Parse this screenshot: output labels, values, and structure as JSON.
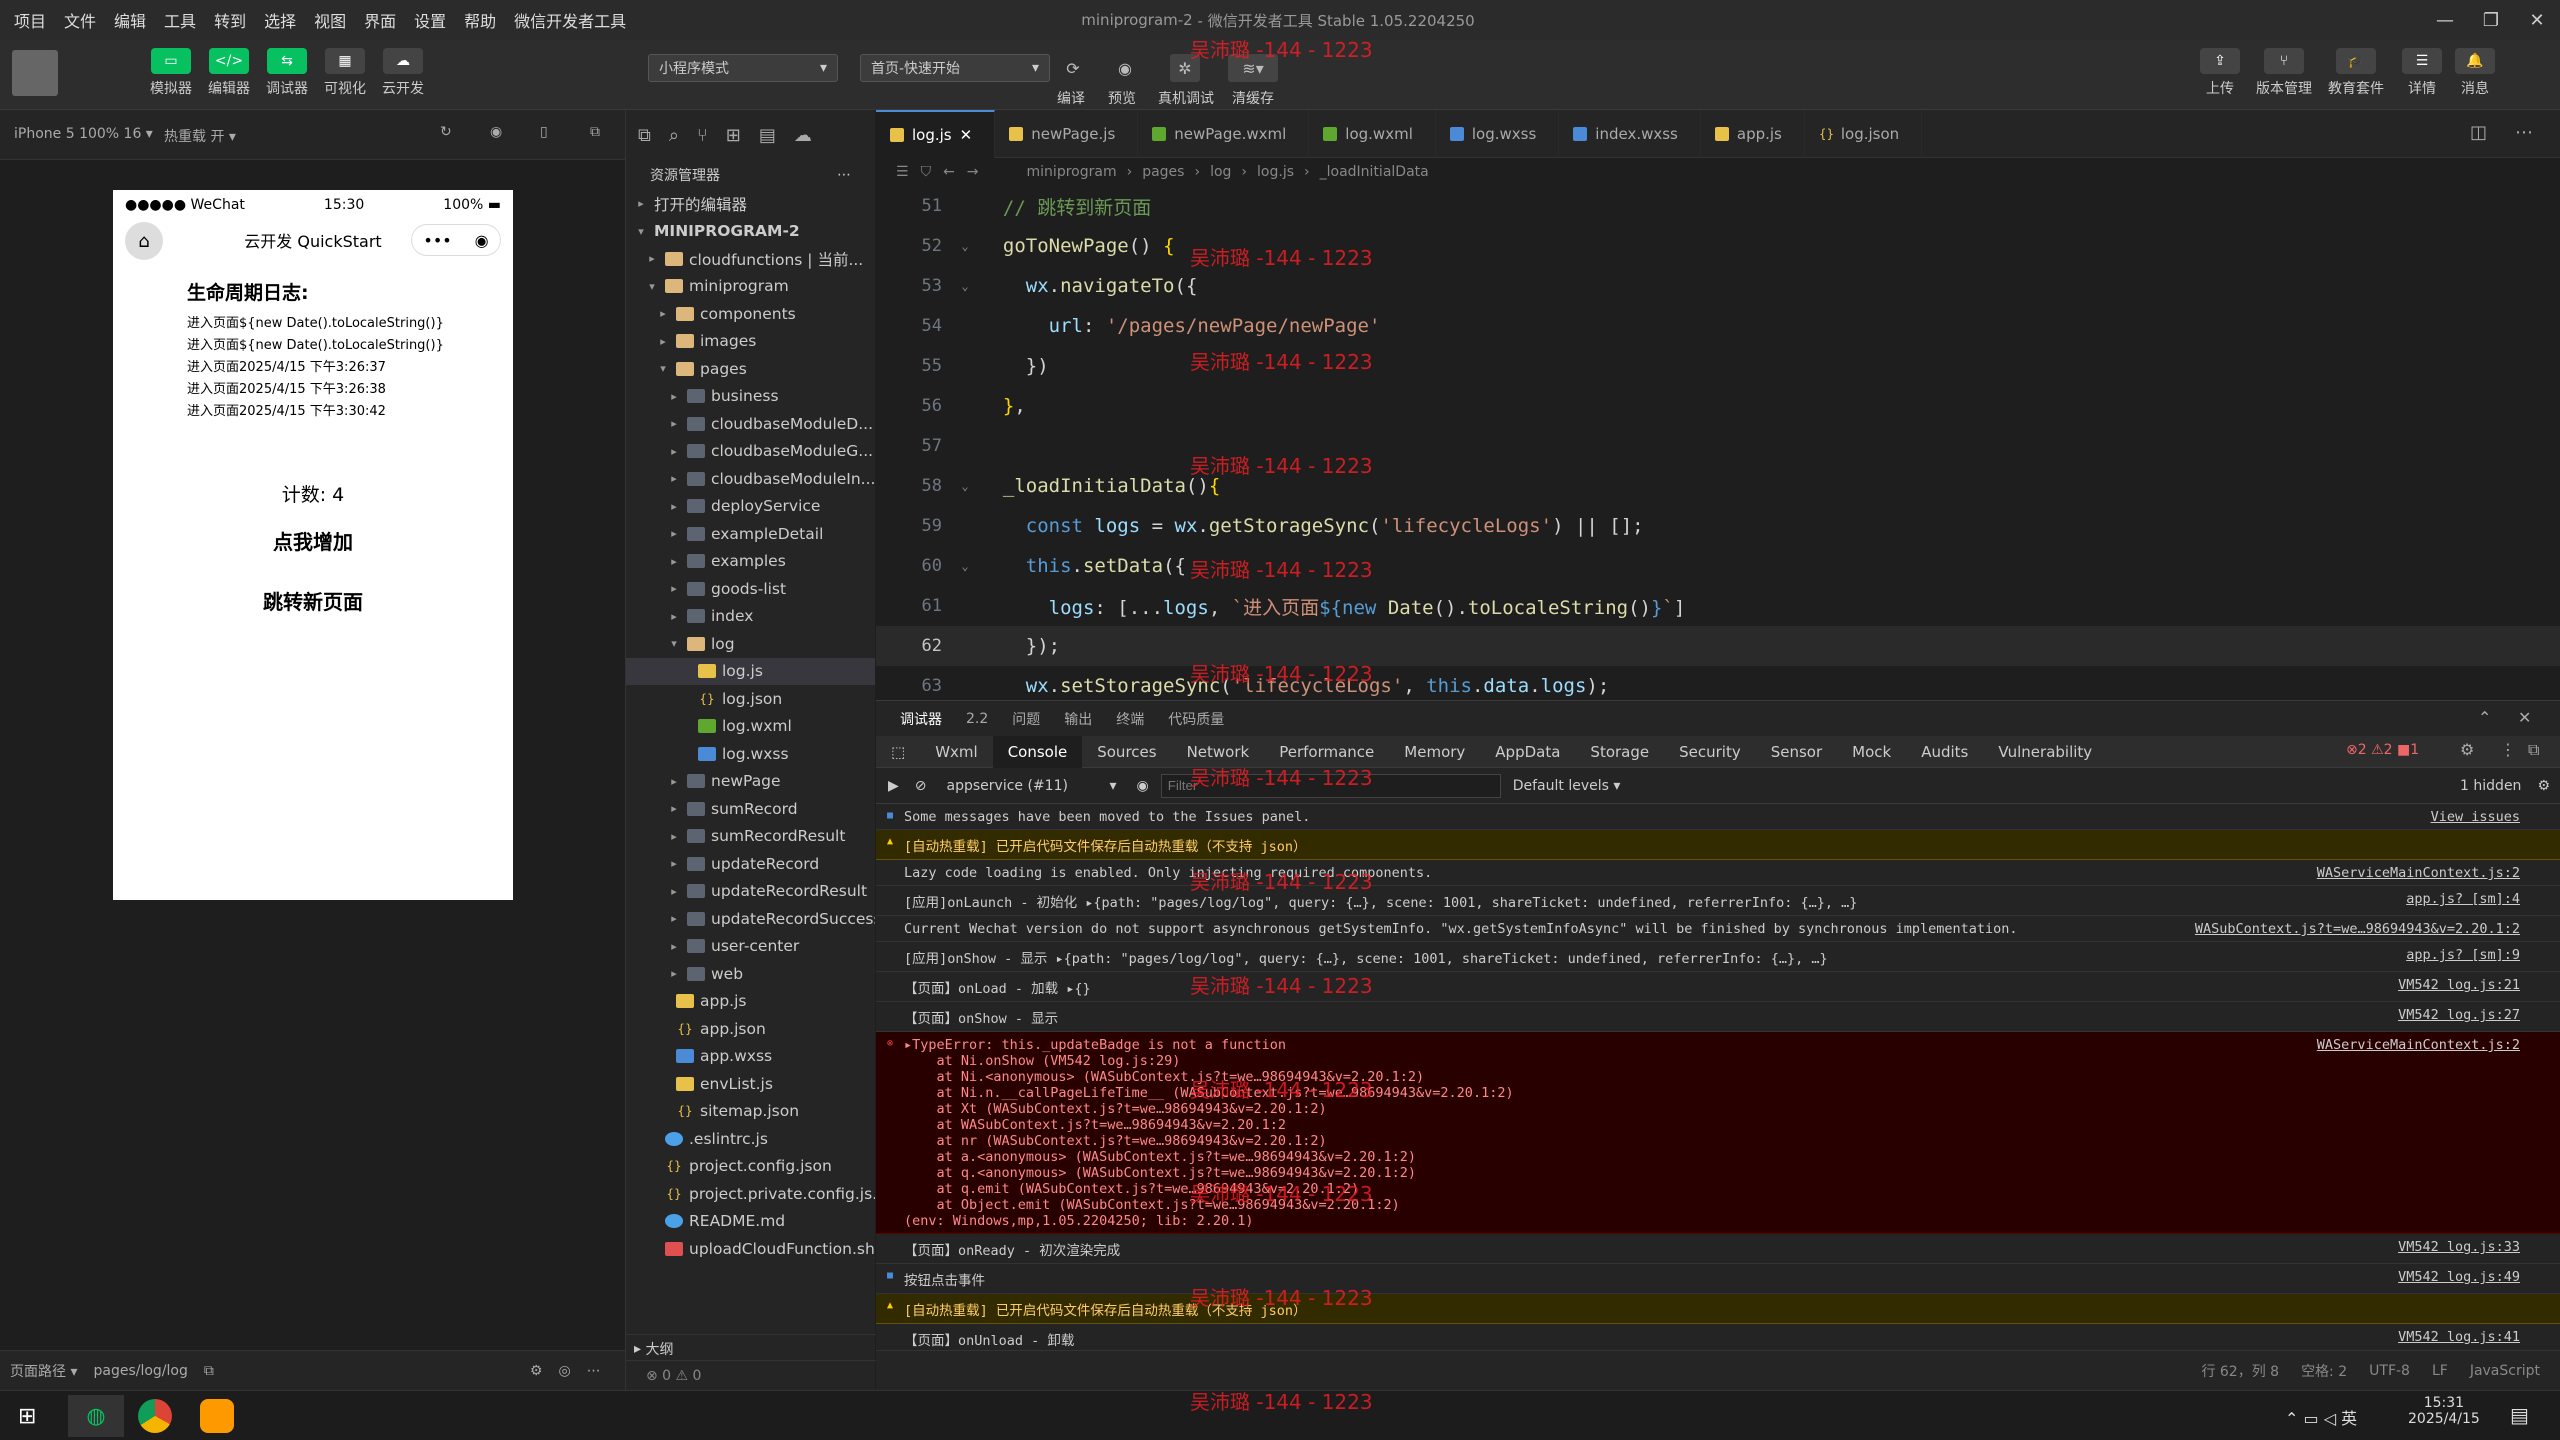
{
  "window": {
    "title": "miniprogram-2",
    "subtitle": "- 微信开发者工具 Stable 1.05.2204250"
  },
  "menu": [
    "项目",
    "文件",
    "编辑",
    "工具",
    "转到",
    "选择",
    "视图",
    "界面",
    "设置",
    "帮助",
    "微信开发者工具"
  ],
  "toolbar": {
    "left_buttons": [
      {
        "label": "模拟器",
        "icon": "phone-icon"
      },
      {
        "label": "编辑器",
        "icon": "code-icon"
      },
      {
        "label": "调试器",
        "icon": "debug-icon"
      },
      {
        "label": "可视化",
        "icon": "layout-icon"
      },
      {
        "label": "云开发",
        "icon": "cloud-icon"
      }
    ],
    "mode_select": "小程序模式",
    "compile_select": "首页-快速开始",
    "mid_labels": [
      "编译",
      "预览",
      "真机调试",
      "清缓存"
    ],
    "right_buttons": [
      "上传",
      "版本管理",
      "教育套件",
      "详情",
      "消息"
    ]
  },
  "sim": {
    "device": "iPhone 5 100% 16 ▾",
    "hot_reload": "热重载 开 ▾",
    "status_left": "●●●●● WeChat",
    "status_time": "15:30",
    "status_right": "100%",
    "nav_title": "云开发 QuickStart",
    "heading": "生命周期日志:",
    "logs": [
      "进入页面${new Date().toLocaleString()}",
      "进入页面${new Date().toLocaleString()}",
      "进入页面2025/4/15 下午3:26:37",
      "进入页面2025/4/15 下午3:26:38",
      "进入页面2025/4/15 下午3:30:42"
    ],
    "count": "计数: 4",
    "inc_button": "点我增加",
    "jump_button": "跳转新页面",
    "footer_path_label": "页面路径 ▾",
    "footer_path": "pages/log/log"
  },
  "explorer": {
    "title": "资源管理器",
    "open_editors": "打开的编辑器",
    "project": "MINIPROGRAM-2",
    "outline": "大纲",
    "problems": "⊗ 0 ⚠ 0",
    "tree": [
      {
        "d": 1,
        "arr": "▸",
        "type": "folder special",
        "name": "cloudfunctions | 当前..."
      },
      {
        "d": 1,
        "arr": "▾",
        "type": "folder special",
        "name": "miniprogram"
      },
      {
        "d": 2,
        "arr": "▸",
        "type": "folder special",
        "name": "components"
      },
      {
        "d": 2,
        "arr": "▸",
        "type": "folder special",
        "name": "images"
      },
      {
        "d": 2,
        "arr": "▾",
        "type": "folder special",
        "name": "pages"
      },
      {
        "d": 3,
        "arr": "▸",
        "type": "folder",
        "name": "business"
      },
      {
        "d": 3,
        "arr": "▸",
        "type": "folder",
        "name": "cloudbaseModuleD..."
      },
      {
        "d": 3,
        "arr": "▸",
        "type": "folder",
        "name": "cloudbaseModuleG..."
      },
      {
        "d": 3,
        "arr": "▸",
        "type": "folder",
        "name": "cloudbaseModuleIn..."
      },
      {
        "d": 3,
        "arr": "▸",
        "type": "folder",
        "name": "deployService"
      },
      {
        "d": 3,
        "arr": "▸",
        "type": "folder",
        "name": "exampleDetail"
      },
      {
        "d": 3,
        "arr": "▸",
        "type": "folder",
        "name": "examples"
      },
      {
        "d": 3,
        "arr": "▸",
        "type": "folder",
        "name": "goods-list"
      },
      {
        "d": 3,
        "arr": "▸",
        "type": "folder",
        "name": "index"
      },
      {
        "d": 3,
        "arr": "▾",
        "type": "folder special",
        "name": "log"
      },
      {
        "d": 4,
        "arr": "",
        "type": "js",
        "name": "log.js",
        "sel": true
      },
      {
        "d": 4,
        "arr": "",
        "type": "json",
        "name": "log.json"
      },
      {
        "d": 4,
        "arr": "",
        "type": "wxml",
        "name": "log.wxml"
      },
      {
        "d": 4,
        "arr": "",
        "type": "wxss",
        "name": "log.wxss"
      },
      {
        "d": 3,
        "arr": "▸",
        "type": "folder",
        "name": "newPage"
      },
      {
        "d": 3,
        "arr": "▸",
        "type": "folder",
        "name": "sumRecord"
      },
      {
        "d": 3,
        "arr": "▸",
        "type": "folder",
        "name": "sumRecordResult"
      },
      {
        "d": 3,
        "arr": "▸",
        "type": "folder",
        "name": "updateRecord"
      },
      {
        "d": 3,
        "arr": "▸",
        "type": "folder",
        "name": "updateRecordResult"
      },
      {
        "d": 3,
        "arr": "▸",
        "type": "folder",
        "name": "updateRecordSuccess"
      },
      {
        "d": 3,
        "arr": "▸",
        "type": "folder",
        "name": "user-center"
      },
      {
        "d": 3,
        "arr": "▸",
        "type": "folder",
        "name": "web"
      },
      {
        "d": 2,
        "arr": "",
        "type": "js",
        "name": "app.js"
      },
      {
        "d": 2,
        "arr": "",
        "type": "json",
        "name": "app.json"
      },
      {
        "d": 2,
        "arr": "",
        "type": "wxss",
        "name": "app.wxss"
      },
      {
        "d": 2,
        "arr": "",
        "type": "js",
        "name": "envList.js"
      },
      {
        "d": 2,
        "arr": "",
        "type": "json",
        "name": "sitemap.json"
      },
      {
        "d": 1,
        "arr": "",
        "type": "md",
        "name": ".eslintrc.js"
      },
      {
        "d": 1,
        "arr": "",
        "type": "json",
        "name": "project.config.json"
      },
      {
        "d": 1,
        "arr": "",
        "type": "json",
        "name": "project.private.config.js..."
      },
      {
        "d": 1,
        "arr": "",
        "type": "md",
        "name": "README.md"
      },
      {
        "d": 1,
        "arr": "",
        "type": "sh",
        "name": "uploadCloudFunction.sh"
      }
    ]
  },
  "tabs": [
    {
      "name": "log.js",
      "type": "js",
      "active": true
    },
    {
      "name": "newPage.js",
      "type": "js"
    },
    {
      "name": "newPage.wxml",
      "type": "wxml"
    },
    {
      "name": "log.wxml",
      "type": "wxml"
    },
    {
      "name": "log.wxss",
      "type": "wxss"
    },
    {
      "name": "index.wxss",
      "type": "wxss"
    },
    {
      "name": "app.js",
      "type": "js"
    },
    {
      "name": "log.json",
      "type": "json"
    }
  ],
  "breadcrumb": [
    "miniprogram",
    "pages",
    "log",
    "log.js",
    "_loadInitialData"
  ],
  "code": [
    {
      "n": "51",
      "html": "  <span class='c'>// 跳转到新页面</span>"
    },
    {
      "n": "52",
      "fold": "⌄",
      "html": "  <span class='f'>goToNewPage</span>() <span class='y'>{</span>"
    },
    {
      "n": "53",
      "fold": "⌄",
      "html": "    <span class='p'>wx</span>.<span class='f'>navigateTo</span>({"
    },
    {
      "n": "54",
      "html": "      <span class='p'>url</span>: <span class='s'>'/pages/newPage/newPage'</span>"
    },
    {
      "n": "55",
      "html": "    })"
    },
    {
      "n": "56",
      "html": "  <span class='y'>}</span>,"
    },
    {
      "n": "57",
      "html": ""
    },
    {
      "n": "58",
      "fold": "⌄",
      "html": "  <span class='f'>_loadInitialData</span>()<span class='y'>{</span>"
    },
    {
      "n": "59",
      "html": "    <span class='k'>const</span> <span class='p'>logs</span> = <span class='p'>wx</span>.<span class='f'>getStorageSync</span>(<span class='s'>'lifecycleLogs'</span>) || [];"
    },
    {
      "n": "60",
      "fold": "⌄",
      "html": "    <span class='k'>this</span>.<span class='f'>setData</span>({"
    },
    {
      "n": "61",
      "html": "      <span class='p'>logs</span>: [...<span class='p'>logs</span>, <span class='s'>`进入页面</span><span class='k'>${</span><span class='k'>new</span> <span class='f'>Date</span>().<span class='f'>toLocaleString</span>()<span class='k'>}</span><span class='s'>`</span>]"
    },
    {
      "n": "62",
      "cur": true,
      "html": "    });"
    },
    {
      "n": "63",
      "html": "    <span class='p'>wx</span>.<span class='f'>setStorageSync</span>(<span class='s'>'lifecycleLogs'</span>, <span class='k'>this</span>.<span class='p'>data</span>.<span class='p'>logs</span>);"
    }
  ],
  "dev_panel_tabs": [
    "调试器",
    "2.2",
    "问题",
    "输出",
    "终端",
    "代码质量"
  ],
  "dev_tabs": [
    "Wxml",
    "Console",
    "Sources",
    "Network",
    "Performance",
    "Memory",
    "AppData",
    "Storage",
    "Security",
    "Sensor",
    "Mock",
    "Audits",
    "Vulnerability"
  ],
  "dev_counts": "⊗2 ⚠2 ■1",
  "context": "appservice (#11)",
  "filter_placeholder": "Filter",
  "levels": "Default levels ▾",
  "hidden": "1 hidden",
  "console": [
    {
      "k": "info",
      "t": "Some messages have been moved to the Issues panel.",
      "s": "View issues"
    },
    {
      "k": "warn",
      "t": "[自动热重载] 已开启代码文件保存后自动热重载（不支持 json）",
      "s": ""
    },
    {
      "k": "",
      "t": "Lazy code loading is enabled. Only injecting required components.",
      "s": "WAServiceMainContext.js:2"
    },
    {
      "k": "",
      "t": "[应用]onLaunch - 初始化 ▸{path: \"pages/log/log\", query: {…}, scene: 1001, shareTicket: undefined, referrerInfo: {…}, …}",
      "s": "app.js? [sm]:4"
    },
    {
      "k": "",
      "t": "Current Wechat version do not support asynchronous getSystemInfo. \"wx.getSystemInfoAsync\" will be finished by synchronous implementation.",
      "s": "WASubContext.js?t=we…98694943&v=2.20.1:2"
    },
    {
      "k": "",
      "t": "[应用]onShow - 显示 ▸{path: \"pages/log/log\", query: {…}, scene: 1001, shareTicket: undefined, referrerInfo: {…}, …}",
      "s": "app.js? [sm]:9"
    },
    {
      "k": "",
      "t": "【页面】onLoad - 加载 ▸{}",
      "s": "VM542 log.js:21"
    },
    {
      "k": "",
      "t": "【页面】onShow - 显示",
      "s": "VM542 log.js:27"
    },
    {
      "k": "err",
      "t": "▸TypeError: this._updateBadge is not a function\n    at Ni.onShow (VM542 log.js:29)\n    at Ni.<anonymous> (WASubContext.js?t=we…98694943&v=2.20.1:2)\n    at Ni.n.__callPageLifeTime__ (WASubContext.js?t=we…98694943&v=2.20.1:2)\n    at Xt (WASubContext.js?t=we…98694943&v=2.20.1:2)\n    at WASubContext.js?t=we…98694943&v=2.20.1:2\n    at nr (WASubContext.js?t=we…98694943&v=2.20.1:2)\n    at a.<anonymous> (WASubContext.js?t=we…98694943&v=2.20.1:2)\n    at q.<anonymous> (WASubContext.js?t=we…98694943&v=2.20.1:2)\n    at q.emit (WASubContext.js?t=we…98694943&v=2.20.1:2)\n    at Object.emit (WASubContext.js?t=we…98694943&v=2.20.1:2)\n(env: Windows,mp,1.05.2204250; lib: 2.20.1)",
      "s": "WAServiceMainContext.js:2"
    },
    {
      "k": "",
      "t": "【页面】onReady - 初次渲染完成",
      "s": "VM542 log.js:33"
    },
    {
      "k": "info",
      "t": "按钮点击事件",
      "s": "VM542 log.js:49"
    },
    {
      "k": "warn",
      "t": "[自动热重载] 已开启代码文件保存后自动热重载（不支持 json）",
      "s": ""
    },
    {
      "k": "",
      "t": "【页面】onUnload - 卸载",
      "s": "VM542 log.js:41"
    }
  ],
  "statusbar": [
    "行 62，列 8",
    "空格: 2",
    "UTF-8",
    "LF",
    "JavaScript"
  ],
  "taskbar": {
    "time": "15:31",
    "date": "2025/4/15",
    "ime": "英"
  },
  "watermark": "吴沛璐 -144 - 1223",
  "colors": {
    "accent": "#07c160",
    "error_bg": "#290000",
    "warn_bg": "#332b00",
    "watermark": "#e81e25"
  }
}
